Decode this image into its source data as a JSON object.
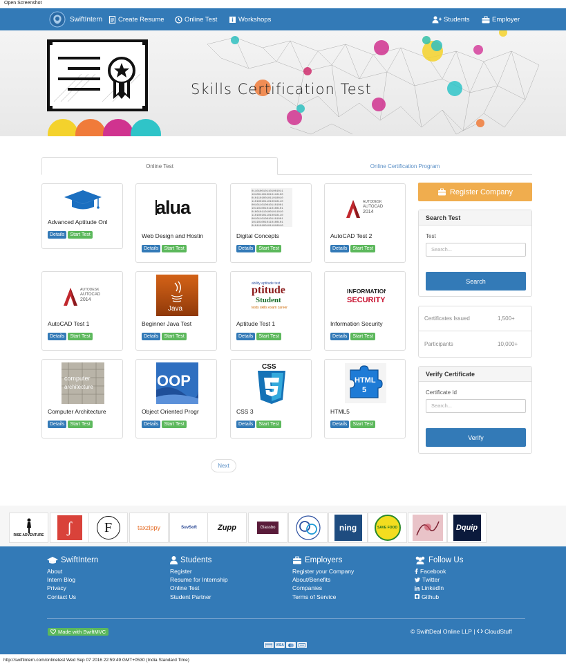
{
  "print_header": "Open Screenshot",
  "status_bar": "http://swiftintern.com/onlinetest Wed Sep 07 2016 22:59:49 GMT+0530 (India Standard Time)",
  "colors": {
    "primary": "#337ab7",
    "success": "#5cb85c",
    "warning": "#f0ad4e"
  },
  "navbar": {
    "brand": "SwiftIntern",
    "left": [
      {
        "label": "Create Resume",
        "icon": "document-icon"
      },
      {
        "label": "Online Test",
        "icon": "clock-icon"
      },
      {
        "label": "Workshops",
        "icon": "info-icon"
      }
    ],
    "right": [
      {
        "label": "Students",
        "icon": "add-user-icon"
      },
      {
        "label": "Employer",
        "icon": "briefcase-icon"
      }
    ]
  },
  "hero": {
    "title": "Skills Certification Test"
  },
  "tabs": [
    {
      "label": "Online Test",
      "active": true
    },
    {
      "label": "Online Certification Program",
      "active": false
    }
  ],
  "tests": [
    {
      "title": "Advanced Aptitude Onl",
      "image": "graduation-cap"
    },
    {
      "title": "Web Design and Hostin",
      "image": "valua-text"
    },
    {
      "title": "Digital Concepts",
      "image": "binary-code"
    },
    {
      "title": "AutoCAD Test 2",
      "image": "autocad-logo"
    },
    {
      "title": "AutoCAD Test 1",
      "image": "autocad-logo"
    },
    {
      "title": "Beginner Java Test",
      "image": "java-logo"
    },
    {
      "title": "Aptitude Test 1",
      "image": "aptitude-wordcloud"
    },
    {
      "title": "Information Security",
      "image": "infosec-text"
    },
    {
      "title": "Computer Architecture",
      "image": "computer-architecture"
    },
    {
      "title": "Object Oriented Progr",
      "image": "oop-text"
    },
    {
      "title": "CSS 3",
      "image": "css3-logo"
    },
    {
      "title": "HTML5",
      "image": "html5-puzzle"
    }
  ],
  "card_buttons": {
    "details": "Details",
    "start": "Start Test"
  },
  "sidebar": {
    "register": "Register Company",
    "search": {
      "heading": "Search Test",
      "label": "Test",
      "placeholder": "Search...",
      "button": "Search"
    },
    "stats": [
      {
        "label": "Certificates Issued",
        "value": "1,500+"
      },
      {
        "label": "Participants",
        "value": "10,000+"
      }
    ],
    "verify": {
      "heading": "Verify Certificate",
      "label": "Certificate Id",
      "placeholder": "Search...",
      "button": "Verify"
    }
  },
  "pagination": {
    "next": "Next"
  },
  "partners": [
    {
      "text": "RISE ADVENTURE"
    },
    {
      "text": "ʃ"
    },
    {
      "text": "F"
    },
    {
      "text": "taxzippy"
    },
    {
      "text": "SuvSoft"
    },
    {
      "text": "Zupp"
    },
    {
      "text": "Glassbo"
    },
    {
      "text": ""
    },
    {
      "text": "ning"
    },
    {
      "text": "SAVE FOOD"
    },
    {
      "text": ""
    },
    {
      "text": "Dquip"
    }
  ],
  "footer": {
    "columns": [
      {
        "heading": "SwiftIntern",
        "icon": "graduation-cap-icon",
        "links": [
          "About",
          "Intern Blog",
          "Privacy",
          "Contact Us"
        ]
      },
      {
        "heading": "Students",
        "icon": "user-icon",
        "links": [
          "Register",
          "Resume for Internship",
          "Online Test",
          "Student Partner"
        ]
      },
      {
        "heading": "Employers",
        "icon": "briefcase-icon",
        "links": [
          "Register your Company",
          "About/Benefits",
          "Companies",
          "Terms of Service"
        ]
      },
      {
        "heading": "Follow Us",
        "icon": "users-icon",
        "links": [
          "Facebook",
          "Twitter",
          "LinkedIn",
          "Github"
        ]
      }
    ],
    "made_with": "Made with SwiftMVC",
    "copyright_company": "SwiftDeal Online LLP",
    "copyright_sep": "|",
    "copyright_partner": "CloudStuff",
    "payments": [
      "VISA",
      "MC",
      "AMEX",
      "CARD"
    ]
  }
}
